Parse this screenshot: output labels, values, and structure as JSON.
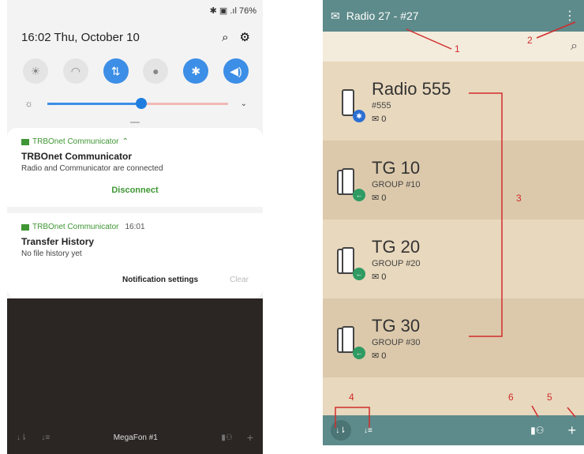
{
  "left_phone": {
    "status": {
      "indicators": "✱ ▣ .ıl 76%"
    },
    "header": {
      "time": "16:02  Thu, October 10"
    },
    "quick_settings": [
      {
        "icon": "flashlight-icon",
        "glyph": "☀",
        "on": false
      },
      {
        "icon": "wifi-icon",
        "glyph": "◠",
        "on": false
      },
      {
        "icon": "data-icon",
        "glyph": "⇅",
        "on": true
      },
      {
        "icon": "location-icon",
        "glyph": "●",
        "on": false
      },
      {
        "icon": "bluetooth-icon",
        "glyph": "✱",
        "on": true
      },
      {
        "icon": "sound-icon",
        "glyph": "◀)",
        "on": true
      }
    ],
    "brightness": {
      "level": 0.52
    },
    "notif1": {
      "app": "TRBOnet Communicator",
      "title": "TRBOnet Communicator",
      "body": "Radio and Communicator are connected",
      "action": "Disconnect"
    },
    "notif2": {
      "app": "TRBOnet Communicator",
      "time": "16:01",
      "title": "Transfer History",
      "body": "No file history yet",
      "settings": "Notification settings",
      "clear": "Clear"
    },
    "dark_bar": {
      "label": "MegaFon #1"
    }
  },
  "right_phone": {
    "title": "Radio 27 - #27",
    "items": [
      {
        "name": "Radio 555",
        "sub": "#555",
        "count": "0",
        "badge": "bluetooth"
      },
      {
        "name": "TG 10",
        "sub": "GROUP #10",
        "count": "0",
        "badge": "arrow"
      },
      {
        "name": "TG 20",
        "sub": "GROUP #20",
        "count": "0",
        "badge": "arrow"
      },
      {
        "name": "TG 30",
        "sub": "GROUP #30",
        "count": "0",
        "badge": "arrow"
      }
    ],
    "annotations": [
      "1",
      "2",
      "3",
      "4",
      "5",
      "6"
    ]
  },
  "colors": {
    "accent_blue": "#3c8ee6",
    "green": "#3f9634",
    "teal": "#5d8a8a",
    "annotation_red": "#d12c2c"
  }
}
